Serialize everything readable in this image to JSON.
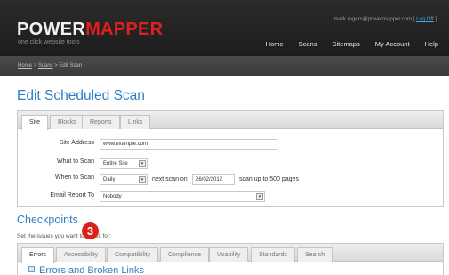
{
  "header": {
    "logo_part1": "POWER",
    "logo_part2": "MAPPER",
    "tagline": "one click website tools",
    "user_email": "mark.rogers@powermapper.com",
    "logoff": "Log Off",
    "nav": [
      "Home",
      "Scans",
      "Sitemaps",
      "My Account",
      "Help"
    ]
  },
  "breadcrumb": {
    "home": "Home",
    "scans": "Scans",
    "current": "Edit Scan",
    "separator": ">"
  },
  "page_title": "Edit Scheduled Scan",
  "settings_tabs": [
    "Site",
    "Blocks",
    "Reports",
    "Links"
  ],
  "form": {
    "site_address_label": "Site Address",
    "site_address_value": "www.example.com",
    "what_label": "What to Scan",
    "what_value": "Entire Site",
    "when_label": "When to Scan",
    "when_value": "Daily",
    "next_scan_text": "next scan on",
    "next_scan_date": "26/02/2012",
    "scan_limit_text": "scan up to 500 pages",
    "email_label": "Email Report To",
    "email_value": "Nobody"
  },
  "checkpoints": {
    "title": "Checkpoints",
    "help_text": "Set the issues you want to check for:",
    "tabs": [
      "Errors",
      "Accessibility",
      "Compatibility",
      "Compliance",
      "Usability",
      "Standards",
      "Search"
    ],
    "section_title": "Errors and Broken Links"
  },
  "badge_number": "3",
  "colors": {
    "accent_blue": "#2e7fc4",
    "logo_red": "#e02020",
    "badge_red": "#d9221c",
    "header_dark": "#222222"
  }
}
